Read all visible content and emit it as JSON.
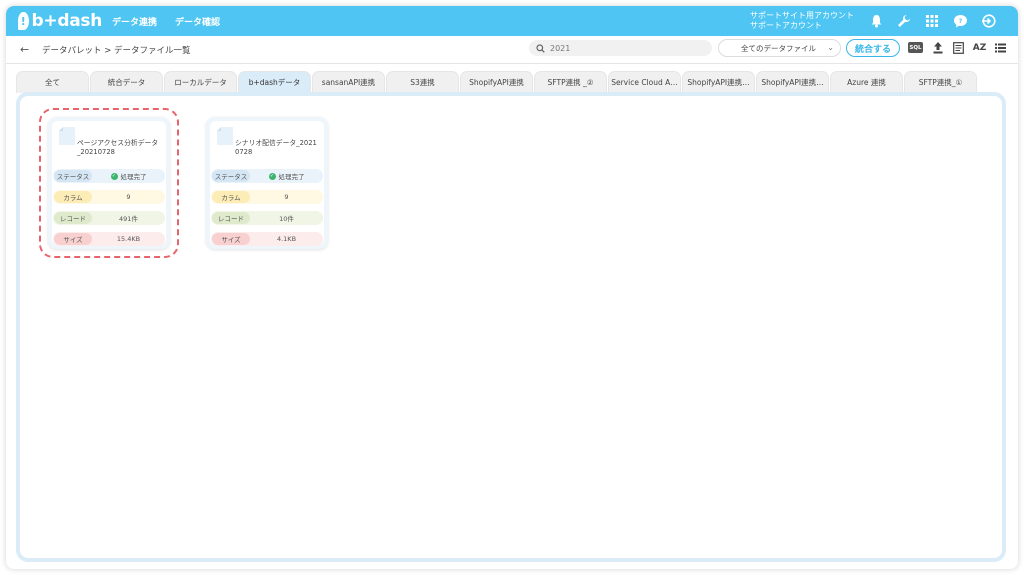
{
  "header": {
    "logo_text": "b+dash",
    "nav": [
      "データ連携",
      "データ確認"
    ],
    "account_line1": "サポートサイト用アカウント",
    "account_line2": "サポートアカウント"
  },
  "subbar": {
    "back_icon": "arrow-left-icon",
    "breadcrumb": "データパレット > データファイル一覧",
    "search_value": "2021",
    "filter_selected": "全てのデータファイル",
    "merge_button": "統合する",
    "sql_label": "SQL",
    "az_label": "AZ"
  },
  "tabs": [
    "全て",
    "統合データ",
    "ローカルデータ",
    "b+dashデータ",
    "sansanAPI連携",
    "S3連携",
    "ShopifyAPI連携",
    "SFTP連携 _②",
    "Service Cloud A…",
    "ShopifyAPI連携…",
    "ShopifyAPI連携…",
    "Azure 連携",
    "SFTP連携_①"
  ],
  "active_tab": "b+dashデータ",
  "labels": {
    "status": "ステータス",
    "columns": "カラム",
    "records": "レコード",
    "size": "サイズ"
  },
  "cards": [
    {
      "title": "ページアクセス分析データ_20210728",
      "status": "処理完了",
      "columns": "9",
      "records": "491件",
      "size": "15.4KB"
    },
    {
      "title": "シナリオ配信データ_20210728",
      "status": "処理完了",
      "columns": "9",
      "records": "10件",
      "size": "4.1KB"
    }
  ],
  "colors": {
    "header": "#4ec5f2",
    "accent": "#39b7ea",
    "selected_ring": "#e8646c",
    "status_ok": "#3bb56b"
  }
}
